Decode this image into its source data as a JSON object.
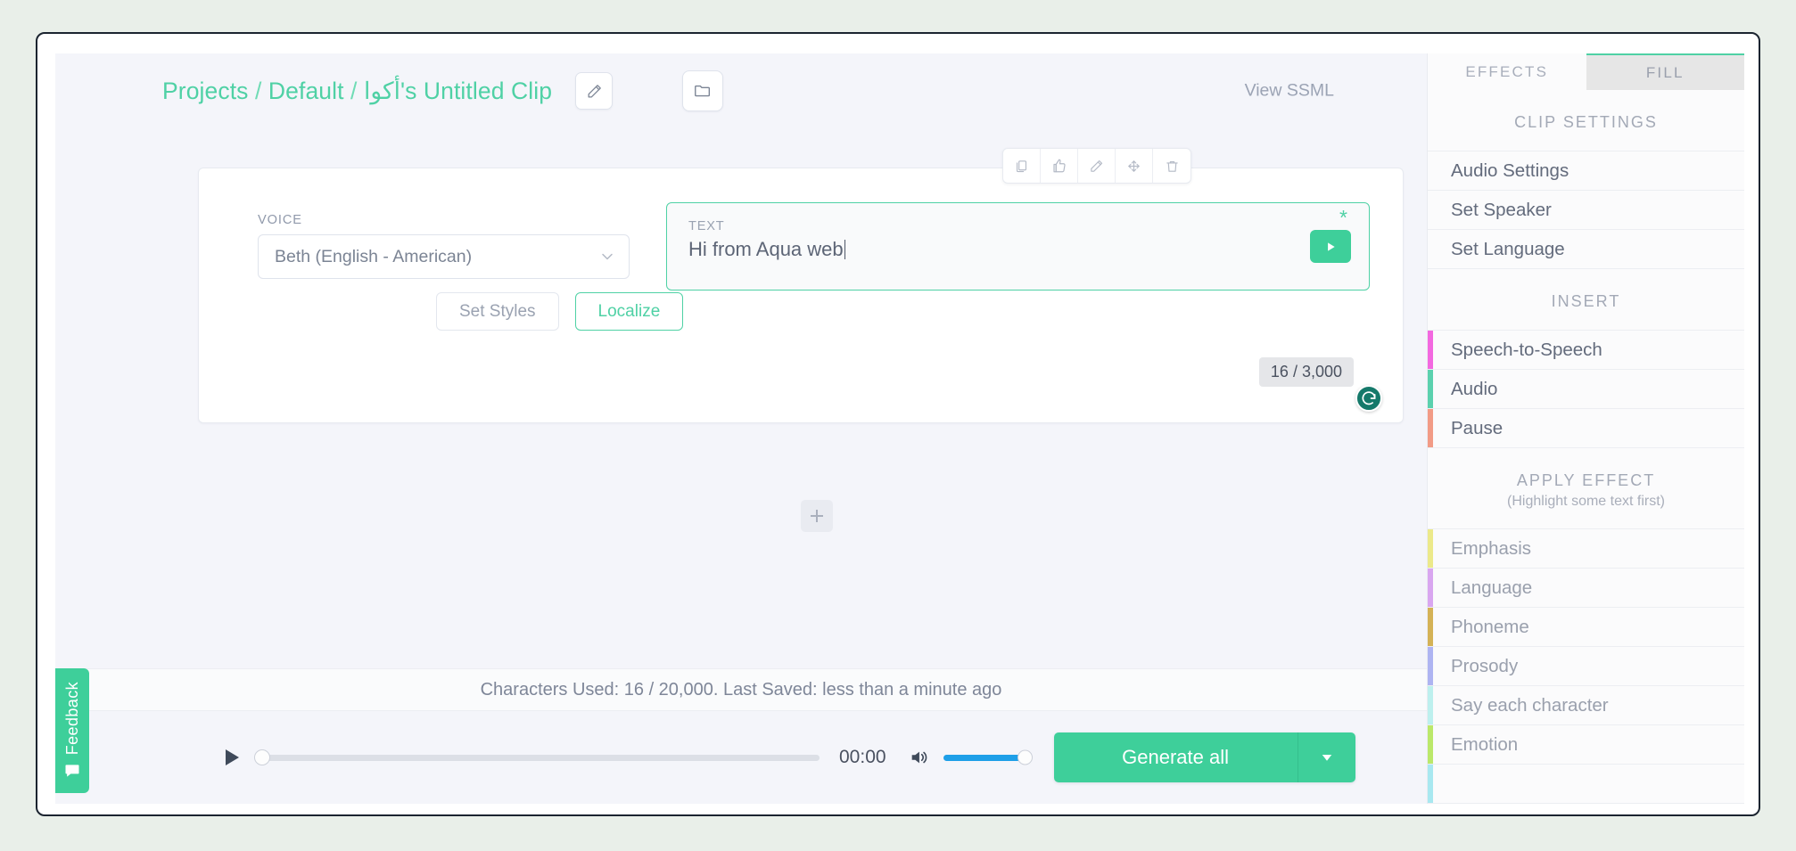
{
  "header": {
    "breadcrumb_projects": "Projects",
    "breadcrumb_sep1": " / ",
    "breadcrumb_default": "Default",
    "breadcrumb_sep2": " / ",
    "breadcrumb_clip": "أكوا's Untitled Clip",
    "edit_icon": "pencil-icon",
    "folder_icon": "folder-icon",
    "view_ssml": "View SSML"
  },
  "clip": {
    "toolbar": [
      {
        "icon": "copy-icon",
        "name": "duplicate-clip-button"
      },
      {
        "icon": "thumbs-up-icon",
        "name": "like-clip-button"
      },
      {
        "icon": "pencil-icon",
        "name": "edit-clip-button"
      },
      {
        "icon": "move-icon",
        "name": "move-clip-button"
      },
      {
        "icon": "trash-icon",
        "name": "delete-clip-button"
      }
    ],
    "voice_label": "VOICE",
    "voice_value": "Beth (English - American)",
    "set_styles_label": "Set Styles",
    "localize_label": "Localize",
    "text_label": "TEXT",
    "text_value": "Hi from Aqua web",
    "required_marker": "*",
    "play_icon": "play-icon",
    "char_counter": "16 / 3,000",
    "grammarly_icon": "grammarly-icon",
    "grammarly_glyph": "G",
    "add_clip_icon": "plus-icon"
  },
  "feedback": {
    "label": "Feedback",
    "icon": "speech-bubble-icon"
  },
  "status": {
    "text": "Characters Used: 16 / 20,000. Last Saved: less than a minute ago"
  },
  "player": {
    "play_icon": "play-icon",
    "time": "00:00",
    "speaker_icon": "volume-icon",
    "seek_value": 0,
    "volume_value": 100,
    "generate_label": "Generate all",
    "generate_caret_icon": "chevron-down-icon"
  },
  "sidebar": {
    "tabs": [
      {
        "label": "EFFECTS",
        "active": false
      },
      {
        "label": "FILL",
        "active": true
      }
    ],
    "clip_settings": {
      "heading": "CLIP SETTINGS",
      "items": [
        {
          "label": "Audio Settings"
        },
        {
          "label": "Set Speaker"
        },
        {
          "label": "Set Language"
        }
      ]
    },
    "insert": {
      "heading": "INSERT",
      "items": [
        {
          "label": "Speech-to-Speech",
          "color": "#f368e0"
        },
        {
          "label": "Audio",
          "color": "#5bd1ae"
        },
        {
          "label": "Pause",
          "color": "#f29b86"
        }
      ]
    },
    "apply_effect": {
      "heading": "APPLY EFFECT",
      "subheading": "(Highlight some text first)",
      "items": [
        {
          "label": "Emphasis",
          "color": "#ece98a"
        },
        {
          "label": "Language",
          "color": "#d9a6f0"
        },
        {
          "label": "Phoneme",
          "color": "#d4b256"
        },
        {
          "label": "Prosody",
          "color": "#aeb4f2"
        },
        {
          "label": "Say each character",
          "color": "#bdf0ee"
        },
        {
          "label": "Emotion",
          "color": "#bbe86a"
        },
        {
          "label": "",
          "color": "#a8e8f0"
        }
      ]
    }
  },
  "colors": {
    "accent_green": "#3ecf9a",
    "breadcrumb_green": "#4fd1a5",
    "volume_blue": "#1e9fe8",
    "page_bg": "#f4f5fa"
  }
}
